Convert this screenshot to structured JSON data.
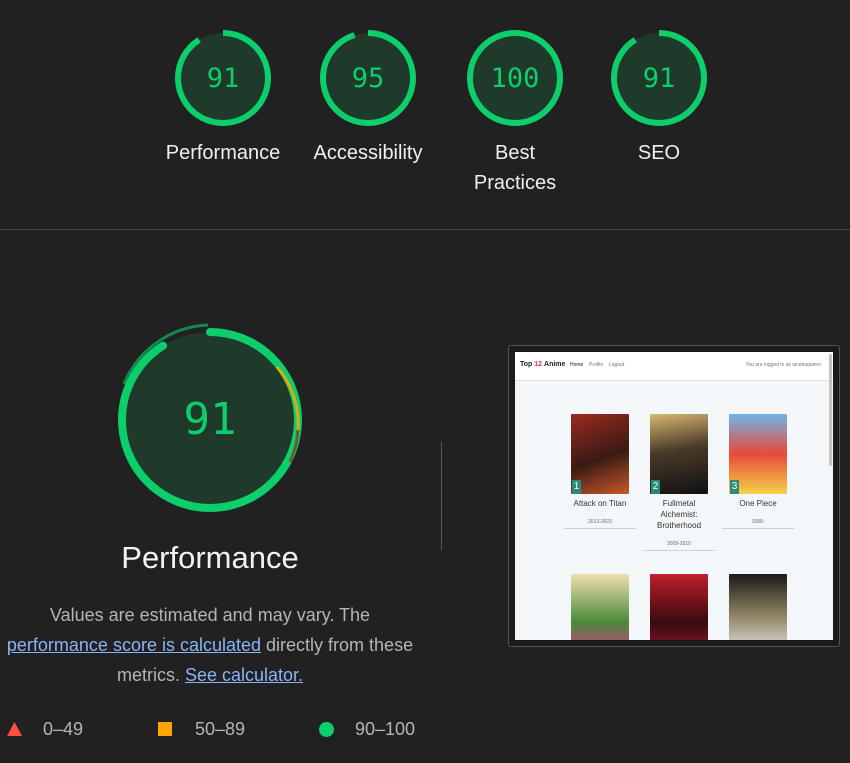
{
  "scores": [
    {
      "value": "91",
      "label": "Performance",
      "fraction": 0.91
    },
    {
      "value": "95",
      "label": "Accessibility",
      "fraction": 0.95
    },
    {
      "value": "100",
      "label": "Best Practices",
      "label_lines": [
        "Best",
        "Practices"
      ],
      "fraction": 1.0
    },
    {
      "value": "91",
      "label": "SEO",
      "fraction": 0.91
    }
  ],
  "main": {
    "score": "91",
    "title": "Performance",
    "desc_text1": "Values are estimated and may vary. The",
    "desc_link1": "performance score is calculated",
    "desc_text2": "directly from these",
    "desc_text3": "metrics.",
    "desc_link2": "See calculator."
  },
  "legend": {
    "fail": "0–49",
    "average": "50–89",
    "pass": "90–100"
  },
  "colors": {
    "pass": "#0cce6b",
    "average": "#ffa400",
    "fail": "#ff4e42",
    "background": "#212121"
  },
  "screenshot": {
    "brand_prefix": "Top",
    "brand_number": "12",
    "brand_suffix": "Anime",
    "nav_home": "Home",
    "nav_profile": "Profile",
    "nav_logout": "Logout",
    "logged_in": "You are logged in as iacebaqueiro",
    "cards": [
      {
        "rank": "1",
        "title": "Attack on Titan",
        "years": "2013-2023"
      },
      {
        "rank": "2",
        "title": "Fullmetal Alchemist: Brotherhood",
        "years": "2009-2010"
      },
      {
        "rank": "3",
        "title": "One Piece",
        "years": "1999-"
      }
    ]
  }
}
